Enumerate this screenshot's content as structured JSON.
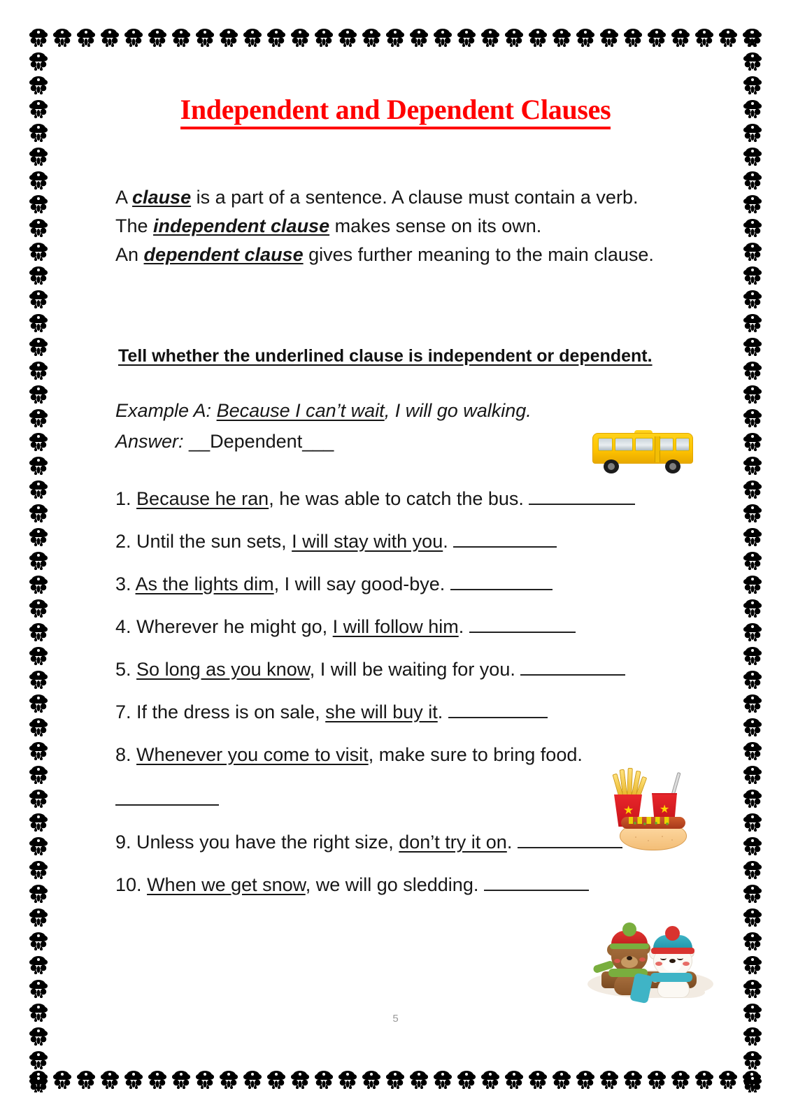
{
  "document": {
    "title": "Independent and Dependent Clauses",
    "title_color": "#FF0000",
    "page_number": "5"
  },
  "intro": {
    "line1_a": " A ",
    "line1_term": "clause",
    "line1_b": " is a part of a sentence. A clause must contain a verb.",
    "line2_a": "The ",
    "line2_term": "independent clause",
    "line2_b": " makes sense on its own.",
    "line3_a": "An ",
    "line3_term": "dependent clause",
    "line3_b": " gives further meaning to the main clause."
  },
  "instruction": "Tell whether the underlined clause is independent or dependent.",
  "example": {
    "label": "Example A: ",
    "underlined": "Because I can’t wait",
    "rest": ", I will go walking.",
    "answer_label": "Answer:  ",
    "answer_value": "__Dependent___"
  },
  "questions": [
    {
      "number": "1.",
      "pre": " ",
      "underlined": "Because he ran",
      "post": ", he was able to catch the bus. ",
      "blank": true
    },
    {
      "number": "2.",
      "pre": " Until the sun sets, ",
      "underlined": "I will stay with you",
      "post": ". ",
      "blank": true
    },
    {
      "number": "3.",
      "pre": " ",
      "underlined": "As the lights dim",
      "post": ", I will say good-bye. ",
      "blank": true
    },
    {
      "number": "4.",
      "pre": " Wherever he might go, ",
      "underlined": "I will follow him",
      "post": ". ",
      "blank": true
    },
    {
      "number": "5.",
      "pre": " ",
      "underlined": "So long as you know",
      "post": ", I will be waiting for you. ",
      "blank": true
    },
    {
      "number": "7.",
      "pre": " If the dress is on sale, ",
      "underlined": "she will buy it",
      "post": ". ",
      "blank": true
    },
    {
      "number": "8.",
      "pre": " ",
      "underlined": "Whenever you come to visit",
      "post": ", make sure to bring food. ",
      "blank": true
    },
    {
      "number": "9.",
      "pre": " Unless you have the right size, ",
      "underlined": "don’t try it on",
      "post": ". ",
      "blank": true
    },
    {
      "number": "10.",
      "pre": " ",
      "underlined": "When we get snow",
      "post": ", we will go sledding. ",
      "blank": true
    }
  ],
  "clipart": {
    "bus": "school-bus",
    "food": "fast-food-fries-drink-hotdog",
    "sled": "sledding-bears"
  },
  "border": {
    "motif": "floral-bow-motif",
    "color": "#000000"
  }
}
